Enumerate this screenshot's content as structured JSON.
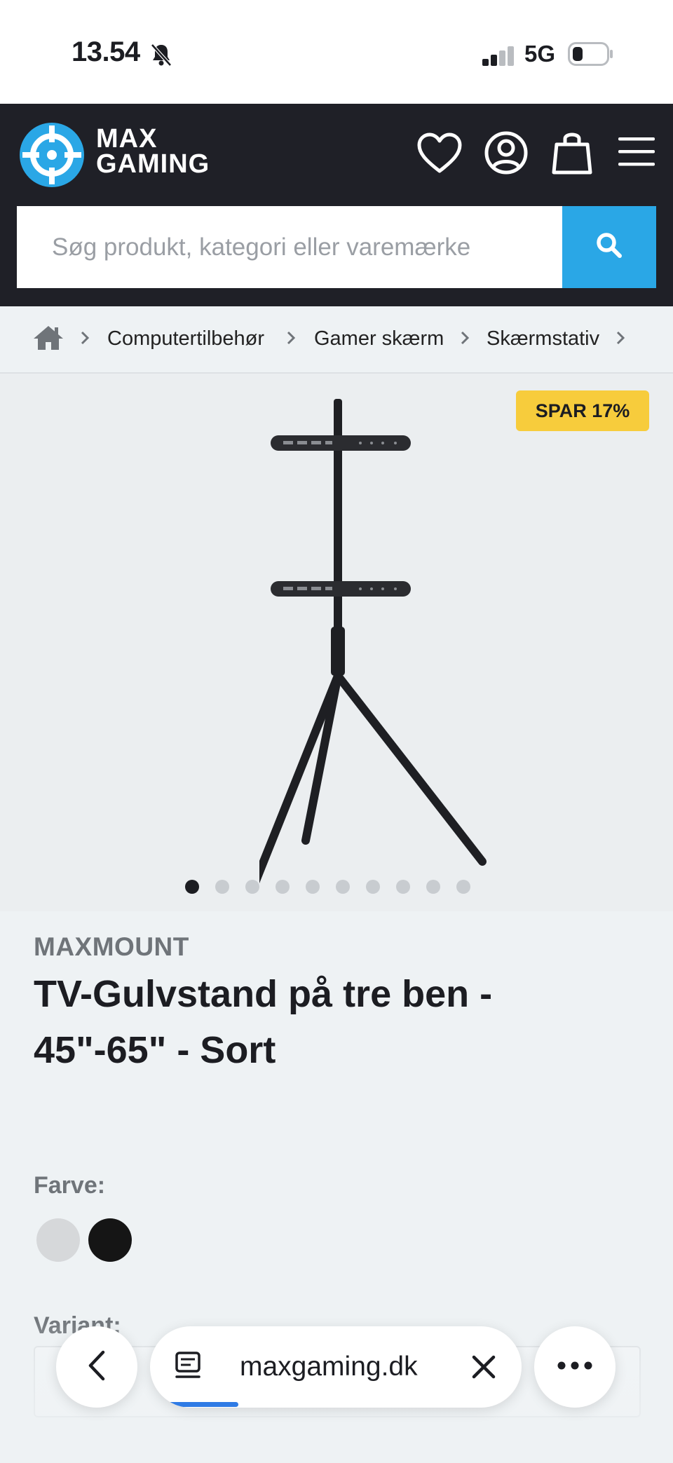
{
  "status_bar": {
    "time": "13.54",
    "network": "5G",
    "icons": [
      "bell-muted-icon",
      "signal-icon",
      "battery-icon"
    ]
  },
  "header": {
    "logo_line1": "MAX",
    "logo_line2": "GAMING",
    "icons": [
      "heart-icon",
      "user-icon",
      "bag-icon",
      "menu-icon"
    ],
    "search": {
      "placeholder": "Søg produkt, kategori eller varemærke",
      "button_icon": "search-icon"
    }
  },
  "breadcrumb": {
    "home_icon": "home-icon",
    "items": [
      "Computertilbehør",
      "Gamer skærm",
      "Skærmstativ"
    ]
  },
  "product": {
    "badge": "SPAR 17%",
    "gallery_total": 10,
    "gallery_active": 1,
    "brand": "MAXMOUNT",
    "title": "TV-Gulvstand på tre ben - 45\"-65\" - Sort",
    "color_label": "Farve:",
    "colors": [
      "#d6d8da",
      "#151515"
    ],
    "variant_label": "Variant:"
  },
  "browser_bar": {
    "url": "maxgaming.dk",
    "icons": [
      "back-icon",
      "page-icon",
      "close-icon",
      "more-icon"
    ]
  },
  "colors": {
    "header_bg": "#1f2027",
    "accent": "#2aa7e6",
    "badge": "#f7cc3c"
  }
}
